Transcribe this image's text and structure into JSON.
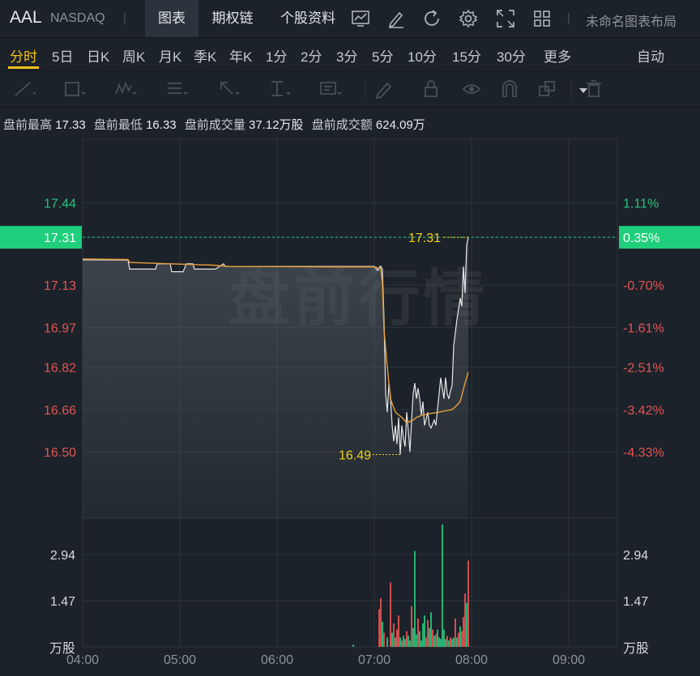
{
  "header": {
    "ticker": "AAL",
    "exchange": "NASDAQ",
    "tabs": [
      {
        "label": "图表",
        "active": true
      },
      {
        "label": "期权链",
        "active": false
      },
      {
        "label": "个股资料",
        "active": false
      }
    ],
    "tool_icons": [
      "indicator-icon",
      "draw-pen-icon",
      "refresh-icon",
      "settings-icon",
      "fullscreen-icon",
      "layout-grid-icon"
    ],
    "layout_name": "未命名图表布局"
  },
  "periods": {
    "items": [
      "分时",
      "5日",
      "日K",
      "周K",
      "月K",
      "季K",
      "年K",
      "1分",
      "2分",
      "3分",
      "5分",
      "10分",
      "15分",
      "30分",
      "更多"
    ],
    "active": "分时",
    "more_icon": "caret-down-icon",
    "auto_label": "自动"
  },
  "drawing_tools": [
    "line-tool-icon",
    "rect-tool-icon",
    "wave-tool-icon",
    "fib-tool-icon",
    "arrow-tool-icon",
    "measure-tool-icon",
    "text-tool-icon",
    "pen-tool-icon",
    "lock-icon",
    "eye-icon",
    "magnet-icon",
    "clone-icon",
    "trash-icon"
  ],
  "stats": {
    "high_label": "盘前最高",
    "high_value": "17.33",
    "low_label": "盘前最低",
    "low_value": "16.33",
    "volume_label": "盘前成交量",
    "volume_value": "37.12万股",
    "amount_label": "盘前成交额",
    "amount_value": "624.09万"
  },
  "colors": {
    "up": "#e35454",
    "down": "#29c17b",
    "current_badge": "#1fcf7c",
    "avg_line": "#e8a03a",
    "price_line": "#e6e6e6",
    "annotation": "#f2d016"
  },
  "chart_data": {
    "type": "line",
    "watermark": "盘前行情",
    "price_ticks": [
      "17.44",
      "17.13",
      "16.97",
      "16.82",
      "16.66",
      "16.50"
    ],
    "pct_ticks": [
      "1.11%",
      "-0.70%",
      "-1.61%",
      "-2.51%",
      "-3.42%",
      "-4.33%"
    ],
    "current_price": "17.31",
    "current_pct": "0.35%",
    "max_label": "17.31",
    "min_label": "16.49",
    "x_ticks": [
      "04:00",
      "05:00",
      "06:00",
      "07:00",
      "08:00",
      "09:00"
    ],
    "volume_ticks": [
      "2.94",
      "1.47"
    ],
    "volume_unit": "万股",
    "y_range": [
      16.25,
      17.68
    ],
    "x_range_min": [
      0,
      330
    ],
    "vol_range": [
      0,
      4.1
    ],
    "price_series": [
      [
        0,
        17.225
      ],
      [
        28,
        17.224
      ],
      [
        29,
        17.19
      ],
      [
        45,
        17.19
      ],
      [
        46,
        17.21
      ],
      [
        54,
        17.21
      ],
      [
        55,
        17.18
      ],
      [
        62,
        17.18
      ],
      [
        64,
        17.21
      ],
      [
        68,
        17.21
      ],
      [
        69,
        17.19
      ],
      [
        82,
        17.19
      ],
      [
        87,
        17.21
      ],
      [
        88,
        17.2
      ],
      [
        180,
        17.2
      ],
      [
        182,
        17.185
      ],
      [
        184,
        17.2
      ],
      [
        183,
        17.2
      ],
      [
        184,
        17.2
      ],
      [
        185,
        17.19
      ],
      [
        186,
        17.0
      ],
      [
        187,
        16.72
      ],
      [
        188,
        16.65
      ],
      [
        189,
        16.76
      ],
      [
        190,
        16.71
      ],
      [
        191,
        16.6
      ],
      [
        192,
        16.54
      ],
      [
        193,
        16.6
      ],
      [
        194,
        16.53
      ],
      [
        195,
        16.63
      ],
      [
        196,
        16.49
      ],
      [
        197,
        16.6
      ],
      [
        198,
        16.55
      ],
      [
        199,
        16.52
      ],
      [
        200,
        16.65
      ],
      [
        201,
        16.58
      ],
      [
        202,
        16.5
      ],
      [
        203,
        16.62
      ],
      [
        204,
        16.72
      ],
      [
        205,
        16.76
      ],
      [
        206,
        16.7
      ],
      [
        207,
        16.74
      ],
      [
        208,
        16.7
      ],
      [
        209,
        16.64
      ],
      [
        210,
        16.69
      ],
      [
        211,
        16.6
      ],
      [
        213,
        16.65
      ],
      [
        214,
        16.6
      ],
      [
        215,
        16.59
      ],
      [
        217,
        16.62
      ],
      [
        218,
        16.6
      ],
      [
        219,
        16.66
      ],
      [
        220,
        16.72
      ],
      [
        221,
        16.78
      ],
      [
        222,
        16.74
      ],
      [
        223,
        16.7
      ],
      [
        224,
        16.78
      ],
      [
        225,
        16.72
      ],
      [
        226,
        16.7
      ],
      [
        227,
        16.73
      ],
      [
        228,
        16.75
      ],
      [
        229,
        16.9
      ],
      [
        231,
        17.0
      ],
      [
        233,
        17.08
      ],
      [
        234,
        17.05
      ],
      [
        235,
        17.2
      ],
      [
        236,
        17.1
      ],
      [
        237,
        17.28
      ],
      [
        238,
        17.31
      ]
    ],
    "avg_series": [
      [
        0,
        17.228
      ],
      [
        28,
        17.226
      ],
      [
        29,
        17.215
      ],
      [
        80,
        17.205
      ],
      [
        90,
        17.2
      ],
      [
        150,
        17.198
      ],
      [
        180,
        17.198
      ],
      [
        182,
        17.195
      ],
      [
        184,
        17.19
      ],
      [
        185,
        17.14
      ],
      [
        186,
        16.96
      ],
      [
        188,
        16.82
      ],
      [
        190,
        16.7
      ],
      [
        193,
        16.65
      ],
      [
        197,
        16.63
      ],
      [
        200,
        16.61
      ],
      [
        204,
        16.62
      ],
      [
        206,
        16.63
      ],
      [
        210,
        16.64
      ],
      [
        215,
        16.645
      ],
      [
        220,
        16.65
      ],
      [
        224,
        16.655
      ],
      [
        228,
        16.66
      ],
      [
        230,
        16.67
      ],
      [
        233,
        16.69
      ],
      [
        236,
        16.76
      ],
      [
        238,
        16.8
      ]
    ],
    "volume_bars": [
      [
        167,
        0.07,
        "down"
      ],
      [
        183,
        1.2,
        "up"
      ],
      [
        184,
        1.55,
        "up"
      ],
      [
        185,
        0.8,
        "down"
      ],
      [
        186,
        0.45,
        "up"
      ],
      [
        188,
        0.3,
        "down"
      ],
      [
        190,
        2.05,
        "up"
      ],
      [
        191,
        0.45,
        "down"
      ],
      [
        192,
        0.75,
        "up"
      ],
      [
        193,
        0.3,
        "down"
      ],
      [
        194,
        0.55,
        "up"
      ],
      [
        195,
        1.0,
        "up"
      ],
      [
        196,
        0.3,
        "down"
      ],
      [
        197,
        0.2,
        "up"
      ],
      [
        198,
        0.35,
        "down"
      ],
      [
        199,
        0.25,
        "down"
      ],
      [
        200,
        0.5,
        "up"
      ],
      [
        201,
        0.35,
        "down"
      ],
      [
        202,
        0.2,
        "down"
      ],
      [
        203,
        1.3,
        "up"
      ],
      [
        204,
        0.6,
        "down"
      ],
      [
        205,
        3.05,
        "down"
      ],
      [
        206,
        0.4,
        "down"
      ],
      [
        207,
        0.9,
        "up"
      ],
      [
        208,
        0.5,
        "down"
      ],
      [
        209,
        0.2,
        "down"
      ],
      [
        210,
        0.75,
        "down"
      ],
      [
        211,
        1.0,
        "down"
      ],
      [
        212,
        0.3,
        "up"
      ],
      [
        213,
        0.85,
        "up"
      ],
      [
        214,
        0.6,
        "down"
      ],
      [
        215,
        1.1,
        "down"
      ],
      [
        216,
        0.55,
        "up"
      ],
      [
        217,
        0.35,
        "down"
      ],
      [
        218,
        0.4,
        "up"
      ],
      [
        219,
        0.55,
        "down"
      ],
      [
        220,
        0.3,
        "down"
      ],
      [
        221,
        0.25,
        "down"
      ],
      [
        222,
        3.9,
        "down"
      ],
      [
        223,
        0.55,
        "down"
      ],
      [
        224,
        0.25,
        "down"
      ],
      [
        225,
        0.35,
        "up"
      ],
      [
        226,
        0.2,
        "down"
      ],
      [
        227,
        0.3,
        "up"
      ],
      [
        228,
        0.25,
        "down"
      ],
      [
        229,
        0.3,
        "down"
      ],
      [
        230,
        0.9,
        "up"
      ],
      [
        231,
        0.3,
        "down"
      ],
      [
        232,
        0.45,
        "up"
      ],
      [
        233,
        0.65,
        "down"
      ],
      [
        234,
        0.5,
        "up"
      ],
      [
        235,
        0.95,
        "up"
      ],
      [
        236,
        1.7,
        "up"
      ],
      [
        237,
        1.4,
        "down"
      ],
      [
        238,
        2.75,
        "up"
      ]
    ]
  }
}
